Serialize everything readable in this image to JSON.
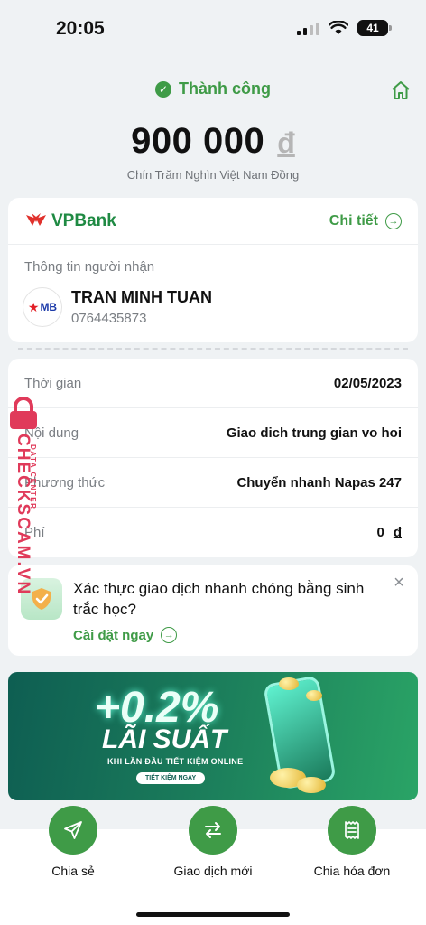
{
  "status_bar": {
    "time": "20:05",
    "battery": "41"
  },
  "result": {
    "status_text": "Thành công",
    "amount": "900 000",
    "currency_symbol": "đ",
    "amount_in_words": "Chín Trăm Nghìn Việt Nam Đồng"
  },
  "bank": {
    "name": "VPBank",
    "detail_link": "Chi tiết"
  },
  "recipient": {
    "section_label": "Thông tin người nhận",
    "bank_logo_text": "MB",
    "name": "TRAN MINH TUAN",
    "account": "0764435873"
  },
  "details": [
    {
      "label": "Thời gian",
      "value": "02/05/2023"
    },
    {
      "label": "Nội dung",
      "value": "Giao dich trung gian vo hoi"
    },
    {
      "label": "Phương thức",
      "value": "Chuyển nhanh Napas 247"
    },
    {
      "label": "Phí",
      "value": "0",
      "currency": "đ"
    }
  ],
  "promo": {
    "text": "Xác thực giao dịch nhanh chóng bằng sinh trắc học?",
    "cta": "Cài đặt ngay"
  },
  "banner": {
    "rate": "+0.2%",
    "title": "LÃI SUẤT",
    "subtitle": "KHI LẦN ĐẦU TIẾT KIỆM ONLINE",
    "button": "TIẾT KIỆM NGAY"
  },
  "actions": [
    {
      "label": "Chia sẻ",
      "icon": "send-icon"
    },
    {
      "label": "Giao dịch mới",
      "icon": "swap-icon"
    },
    {
      "label": "Chia hóa đơn",
      "icon": "receipt-icon"
    }
  ],
  "watermark": {
    "text": "CHECKSCAM.VN",
    "sub": "DATA CENTER"
  },
  "colors": {
    "accent_green": "#3f9b47",
    "background": "#eff2f4",
    "watermark": "#e03a5a"
  }
}
